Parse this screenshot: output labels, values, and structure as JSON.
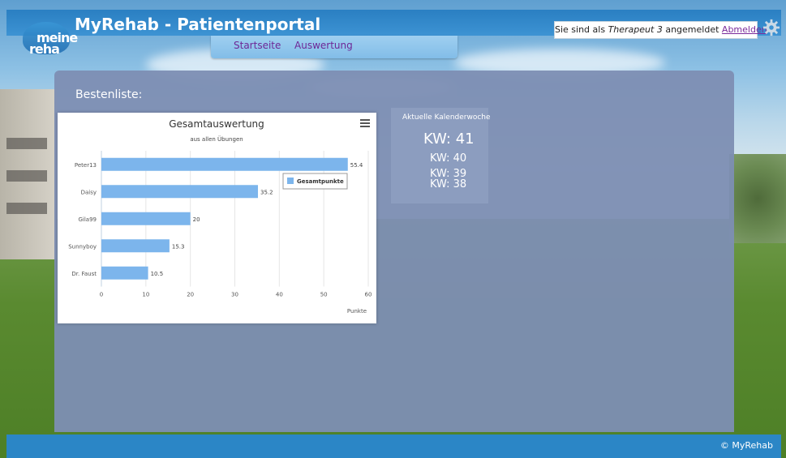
{
  "header": {
    "app_title": "MyRehab - Patientenportal",
    "logo_line1": "meine",
    "logo_line2": "reha",
    "user_prefix": "Sie sind als",
    "user_name": "Therapeut 3",
    "user_suffix": "angemeldet",
    "logout_label": "Abmelden",
    "settings_icon": "gear-icon"
  },
  "nav": {
    "items": [
      {
        "label": "Startseite"
      },
      {
        "label": "Auswertung"
      }
    ]
  },
  "main": {
    "section_title": "Bestenliste:"
  },
  "chart_data": {
    "type": "bar",
    "orientation": "horizontal",
    "title": "Gesamtauswertung",
    "subtitle": "aus allen Übungen",
    "categories": [
      "Peter13",
      "Daisy",
      "Gila99",
      "Sunnyboy",
      "Dr. Faust"
    ],
    "series": [
      {
        "name": "Gesamtpunkte",
        "values": [
          55.4,
          35.2,
          20,
          15.3,
          10.5
        ],
        "color": "#7cb5ec"
      }
    ],
    "data_labels": [
      "55.4",
      "35.2",
      "20",
      "15.3",
      "10.5"
    ],
    "xlabel": "Punkte",
    "ylabel": "",
    "xlim": [
      0,
      60
    ],
    "ticks": [
      "0",
      "10",
      "20",
      "30",
      "40",
      "50",
      "60"
    ],
    "grid": true,
    "legend_position": "top-right"
  },
  "calendar": {
    "heading": "Aktuelle Kalenderwoche",
    "current": "KW: 41",
    "weeks": [
      "KW: 40",
      "KW: 39",
      "KW: 38"
    ]
  },
  "footer": {
    "copyright": "© MyRehab"
  }
}
